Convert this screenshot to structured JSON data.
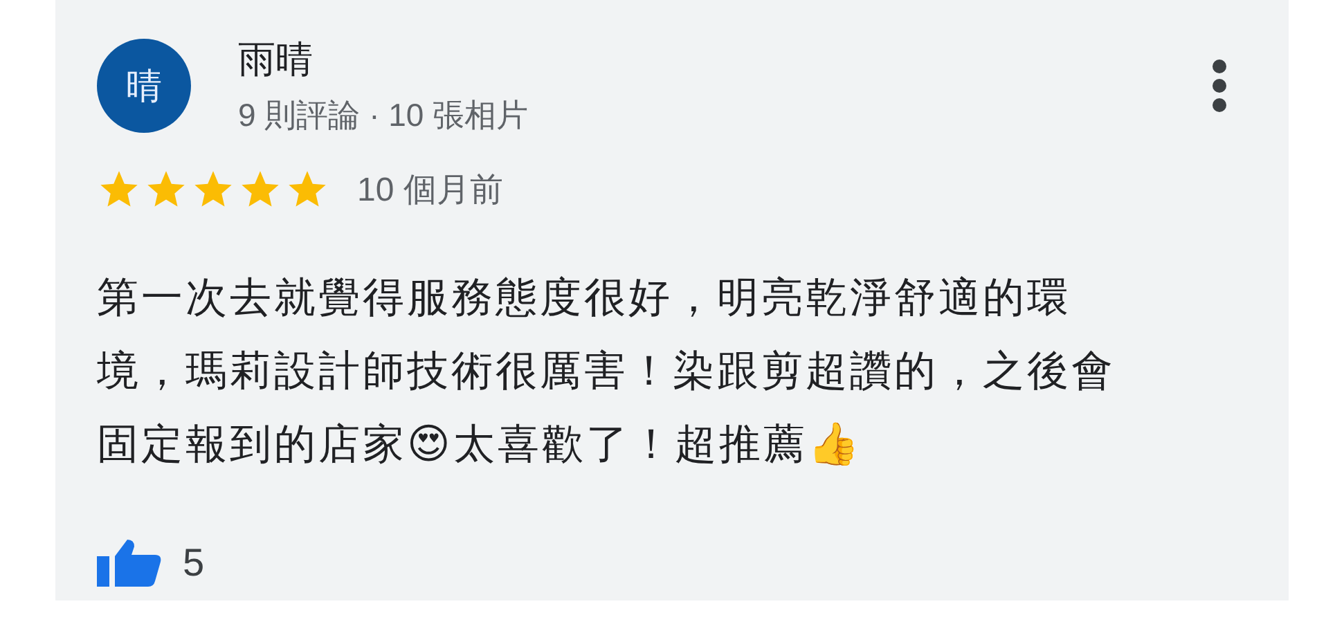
{
  "review": {
    "avatar_letter": "晴",
    "author": "雨晴",
    "author_stats": "9 則評論 · 10 張相片",
    "stars": 5,
    "time": "10 個月前",
    "text_lines": [
      "第一次去就覺得服務態度很好，明亮乾淨舒適的環",
      "境，瑪莉設計師技術很厲害！染跟剪超讚的，之後會",
      "固定報到的店家😍太喜歡了！超推薦👍"
    ],
    "likes": "5"
  }
}
